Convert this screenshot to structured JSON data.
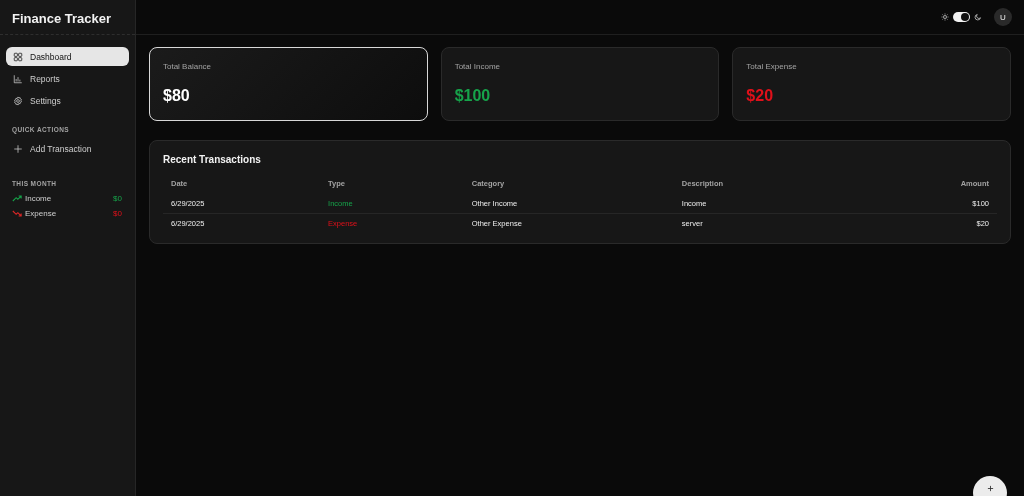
{
  "app": {
    "title": "Finance Tracker"
  },
  "sidebar": {
    "items": [
      {
        "label": "Dashboard",
        "kind": "grid",
        "selected": true
      },
      {
        "label": "Reports",
        "kind": "chart",
        "selected": false
      },
      {
        "label": "Settings",
        "kind": "gear",
        "selected": false
      }
    ],
    "quick_actions": {
      "heading": "QUICK ACTIONS",
      "items": [
        {
          "label": "Add Transaction"
        }
      ]
    },
    "this_month": {
      "heading": "THIS MONTH",
      "items": [
        {
          "label": "Income",
          "amount": "$0",
          "kind": "income"
        },
        {
          "label": "Expense",
          "amount": "$0",
          "kind": "expense"
        }
      ]
    }
  },
  "header": {
    "theme_toggle": {
      "on": true
    },
    "avatar": "U"
  },
  "summary_cards": [
    {
      "label": "Total Balance",
      "value": "$80",
      "kind": "balance",
      "selected": true
    },
    {
      "label": "Total Income",
      "value": "$100",
      "kind": "income",
      "selected": false
    },
    {
      "label": "Total Expense",
      "value": "$20",
      "kind": "expense",
      "selected": false
    }
  ],
  "transactions": {
    "title": "Recent Transactions",
    "columns": [
      "Date",
      "Type",
      "Category",
      "Description",
      "Amount"
    ],
    "rows": [
      {
        "date": "6/29/2025",
        "type": "Income",
        "kind": "income",
        "category": "Other Income",
        "description": "Income",
        "amount": "$100"
      },
      {
        "date": "6/29/2025",
        "type": "Expense",
        "kind": "expense",
        "category": "Other Expense",
        "description": "server",
        "amount": "$20"
      }
    ]
  }
}
